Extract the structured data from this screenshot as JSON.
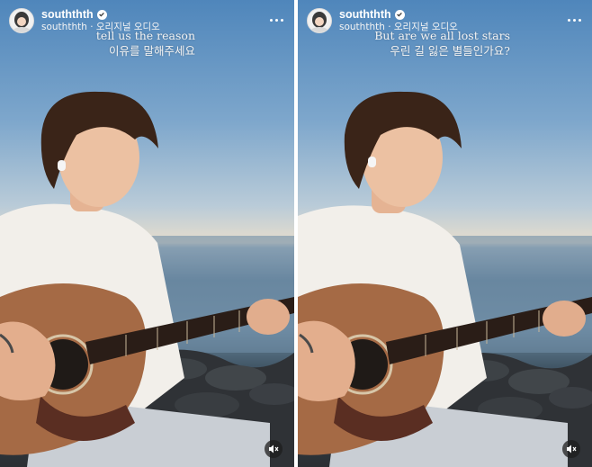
{
  "posts": [
    {
      "username": "souththth",
      "audio_label": "souththth · 오리지널 오디오",
      "caption_line1": "tell us the reason",
      "caption_line2": "이유를 말해주세요"
    },
    {
      "username": "souththth",
      "audio_label": "souththth · 오리지널 오디오",
      "caption_line1": "But are we all lost stars",
      "caption_line2": "우린 길 잃은 별들인가요?"
    }
  ],
  "icons": {
    "verified": "verified-badge-icon",
    "more": "more-options-icon",
    "mute": "speaker-muted-icon"
  },
  "colors": {
    "sky_top": "#4f86bb",
    "horizon": "#e6ddcd",
    "shirt": "#f2efea",
    "guitar": "#a56a45",
    "hair": "#3a2418"
  }
}
